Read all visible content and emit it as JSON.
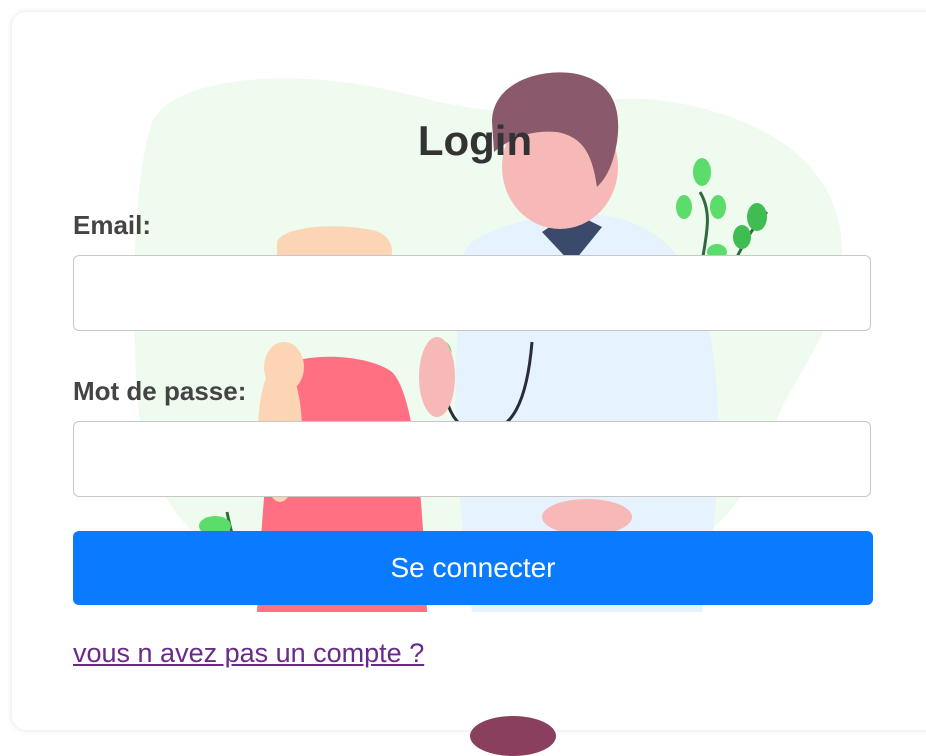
{
  "form": {
    "title": "Login",
    "email_label": "Email:",
    "email_value": "",
    "password_label": "Mot de passe:",
    "password_value": "",
    "submit_label": "Se connecter",
    "signup_link": "vous n avez pas un compte ?"
  },
  "colors": {
    "primary": "#0a7bff",
    "link": "#6a2a8a",
    "text": "#333333",
    "blob": "#eefbee"
  },
  "icons": {
    "illustration": "doctor-patient-illustration"
  }
}
